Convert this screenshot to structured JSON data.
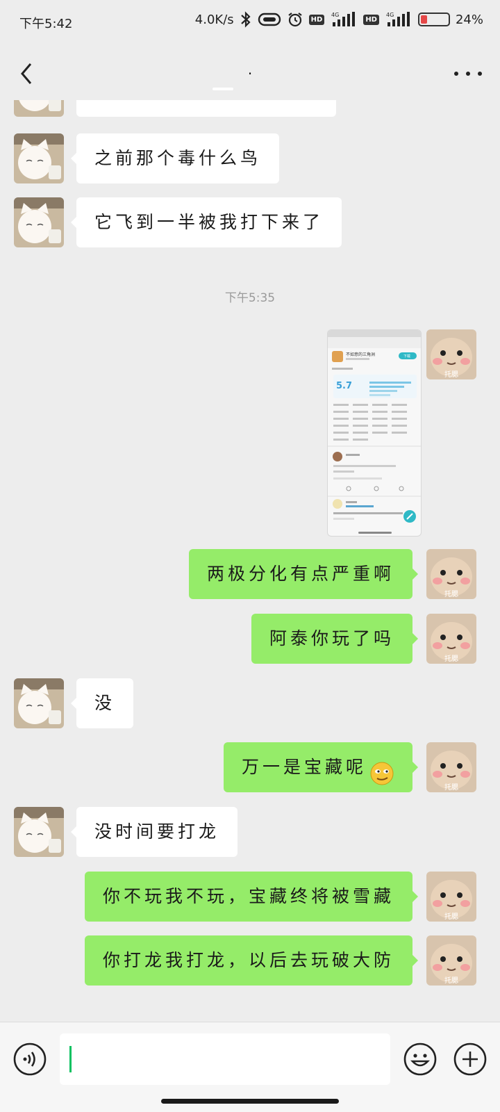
{
  "status_bar": {
    "time": "下午5:42",
    "network_speed": "4.0K/s",
    "signal_label_1": "4G",
    "signal_label_2": "4G",
    "hd_label": "HD",
    "battery_percent": "24%",
    "battery_level": 0.24,
    "battery_color": "#e54848"
  },
  "header": {
    "title": "."
  },
  "timestamp": "下午5:35",
  "messages": [
    {
      "side": "in",
      "text": "之前那个毒什么鸟"
    },
    {
      "side": "in",
      "text": "它飞到一半被我打下来了"
    },
    {
      "side": "out",
      "type": "image"
    },
    {
      "side": "out",
      "text": "两极分化有点严重啊"
    },
    {
      "side": "out",
      "text": "阿泰你玩了吗"
    },
    {
      "side": "in",
      "text": "没"
    },
    {
      "side": "out",
      "text": "万一是宝藏呢",
      "emoji": "smirk-emoji"
    },
    {
      "side": "in",
      "text": "没时间要打龙"
    },
    {
      "side": "out",
      "text": "你不玩我不玩，宝藏终将被雪藏"
    },
    {
      "side": "out",
      "text": "你打龙我打龙，以后去玩破大防"
    }
  ],
  "avatar_self_label": "托腮",
  "shared_image": {
    "app_name": "不如意的三角洲",
    "rating": "5.7",
    "button_label": "下载"
  },
  "input": {
    "value": "",
    "placeholder": ""
  },
  "colors": {
    "bubble_out": "#95ec69",
    "bubble_in": "#ffffff",
    "background": "#ededed",
    "caret": "#07c160"
  }
}
